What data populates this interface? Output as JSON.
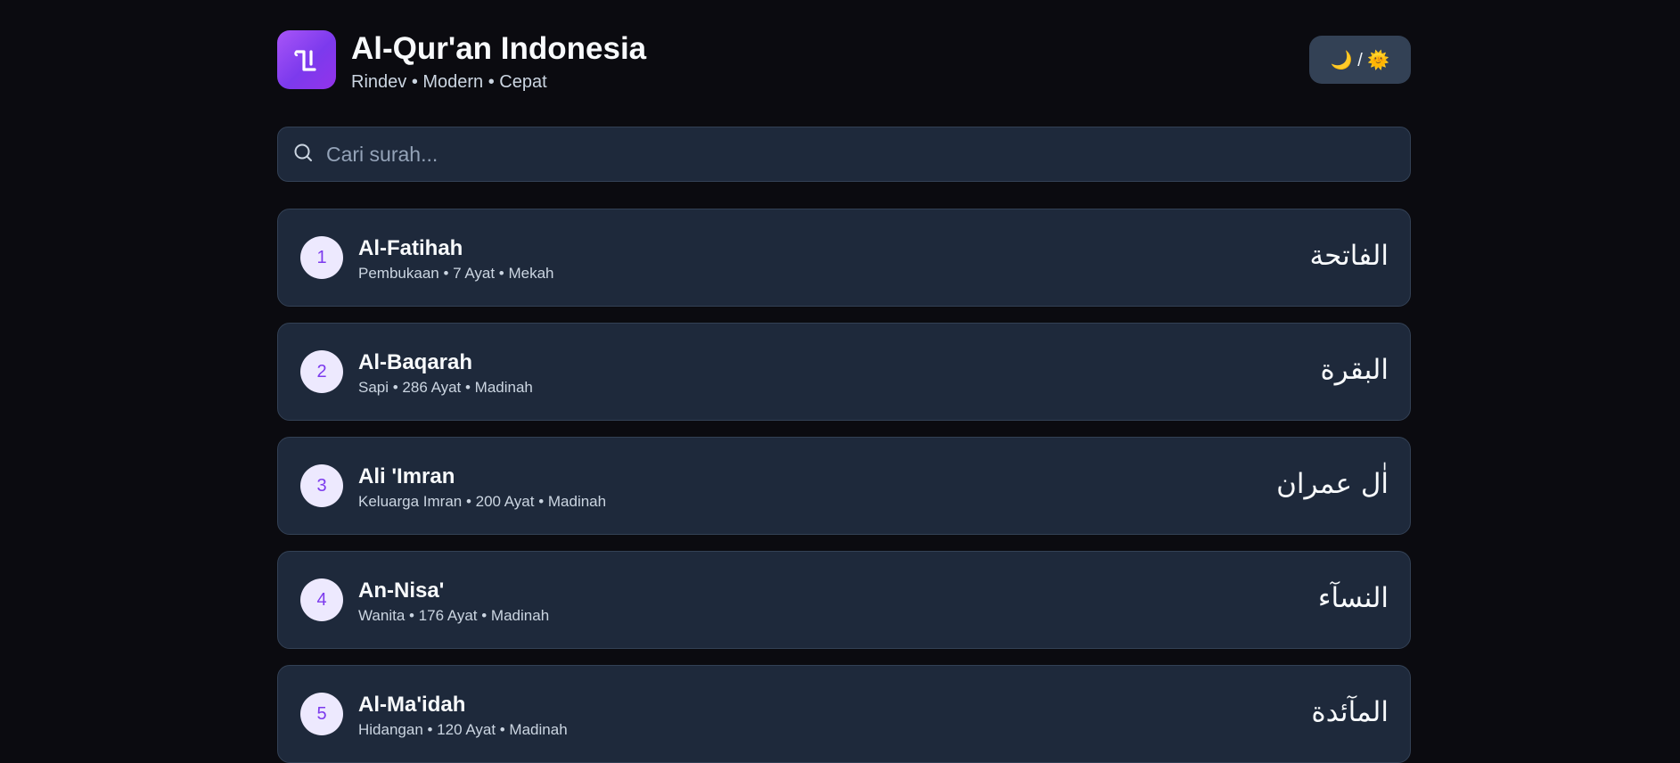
{
  "header": {
    "logo_glyph": "ﺍﻟ",
    "title": "Al-Qur'an Indonesia",
    "subtitle": "Rindev • Modern • Cepat",
    "theme_toggle_label": "🌙 / 🌞"
  },
  "search": {
    "placeholder": "Cari surah...",
    "value": ""
  },
  "colors": {
    "background": "#0b0b10",
    "card": "#1e293b",
    "accent": "#7c3aed",
    "number_badge_bg": "#ede9fe"
  },
  "surahs": [
    {
      "number": "1",
      "name": "Al-Fatihah",
      "meta": "Pembukaan • 7 Ayat • Mekah",
      "arabic": "الفاتحة"
    },
    {
      "number": "2",
      "name": "Al-Baqarah",
      "meta": "Sapi • 286 Ayat • Madinah",
      "arabic": "البقرة"
    },
    {
      "number": "3",
      "name": "Ali 'Imran",
      "meta": "Keluarga Imran • 200 Ayat • Madinah",
      "arabic": "اٰل عمران"
    },
    {
      "number": "4",
      "name": "An-Nisa'",
      "meta": "Wanita • 176 Ayat • Madinah",
      "arabic": "النسآء"
    },
    {
      "number": "5",
      "name": "Al-Ma'idah",
      "meta": "Hidangan • 120 Ayat • Madinah",
      "arabic": "المآئدة"
    }
  ]
}
